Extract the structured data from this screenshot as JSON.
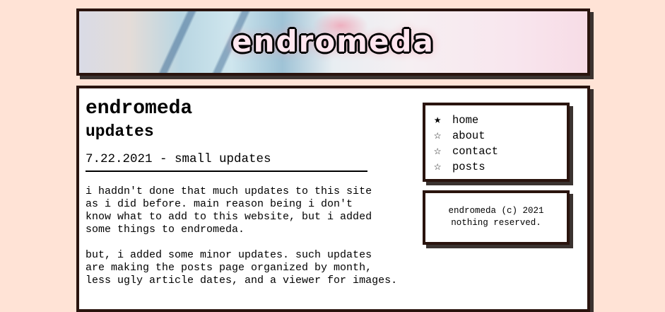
{
  "banner": {
    "logo_text": "endromeda"
  },
  "main": {
    "title": "endromeda",
    "subtitle": "updates",
    "post": {
      "heading": "7.22.2021 - small updates",
      "paragraphs": [
        "i haddn't done that much updates to this site\nas i did before. main reason being i don't\nknow what to add to this website, but i added\nsome things to endromeda.",
        "but, i added some minor updates. such updates\nare making the posts page organized by month,\nless ugly article dates, and a viewer for images."
      ]
    }
  },
  "nav": {
    "items": [
      {
        "label": "home",
        "icon": "star-filled-icon"
      },
      {
        "label": "about",
        "icon": "star-outline-icon"
      },
      {
        "label": "contact",
        "icon": "star-outline-icon"
      },
      {
        "label": "posts",
        "icon": "star-outline-icon"
      }
    ]
  },
  "footer": {
    "line1": "endromeda (c) 2021",
    "line2": "nothing reserved."
  },
  "colors": {
    "background": "#ffe3d6",
    "border": "#2a140e",
    "shadow": "#3b3330"
  }
}
